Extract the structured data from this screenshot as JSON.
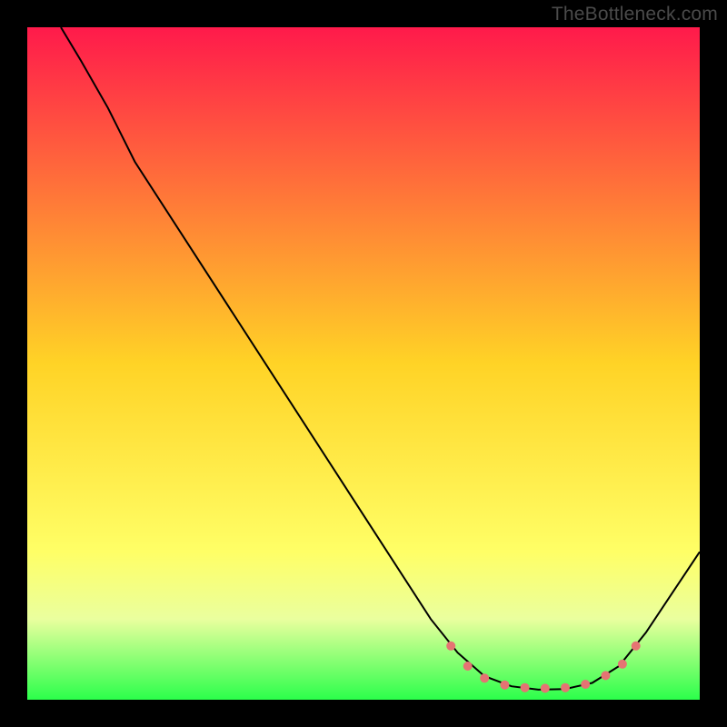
{
  "watermark": "TheBottleneck.com",
  "chart_data": {
    "type": "line",
    "title": "",
    "xlabel": "",
    "ylabel": "",
    "xlim": [
      0,
      100
    ],
    "ylim": [
      0,
      100
    ],
    "grid": false,
    "legend": false,
    "gradient_stops": [
      {
        "offset": 0,
        "color": "#ff1a4b"
      },
      {
        "offset": 50,
        "color": "#ffd326"
      },
      {
        "offset": 78,
        "color": "#ffff66"
      },
      {
        "offset": 88,
        "color": "#eaff9e"
      },
      {
        "offset": 100,
        "color": "#2bff4b"
      }
    ],
    "series": [
      {
        "name": "curve",
        "stroke": "#000000",
        "stroke_width": 2,
        "points": [
          {
            "x": 5,
            "y": 100
          },
          {
            "x": 8,
            "y": 95
          },
          {
            "x": 12,
            "y": 88
          },
          {
            "x": 16,
            "y": 80
          },
          {
            "x": 60,
            "y": 12
          },
          {
            "x": 64,
            "y": 7
          },
          {
            "x": 68,
            "y": 3.5
          },
          {
            "x": 72,
            "y": 2
          },
          {
            "x": 76,
            "y": 1.5
          },
          {
            "x": 80,
            "y": 1.6
          },
          {
            "x": 84,
            "y": 2.5
          },
          {
            "x": 88,
            "y": 5
          },
          {
            "x": 92,
            "y": 10
          },
          {
            "x": 96,
            "y": 16
          },
          {
            "x": 100,
            "y": 22
          }
        ]
      }
    ],
    "markers": {
      "color": "#e57373",
      "radius": 5,
      "points": [
        {
          "x": 63,
          "y": 8
        },
        {
          "x": 65.5,
          "y": 5
        },
        {
          "x": 68,
          "y": 3.2
        },
        {
          "x": 71,
          "y": 2.2
        },
        {
          "x": 74,
          "y": 1.8
        },
        {
          "x": 77,
          "y": 1.7
        },
        {
          "x": 80,
          "y": 1.8
        },
        {
          "x": 83,
          "y": 2.3
        },
        {
          "x": 86,
          "y": 3.6
        },
        {
          "x": 88.5,
          "y": 5.3
        },
        {
          "x": 90.5,
          "y": 8
        }
      ]
    }
  }
}
